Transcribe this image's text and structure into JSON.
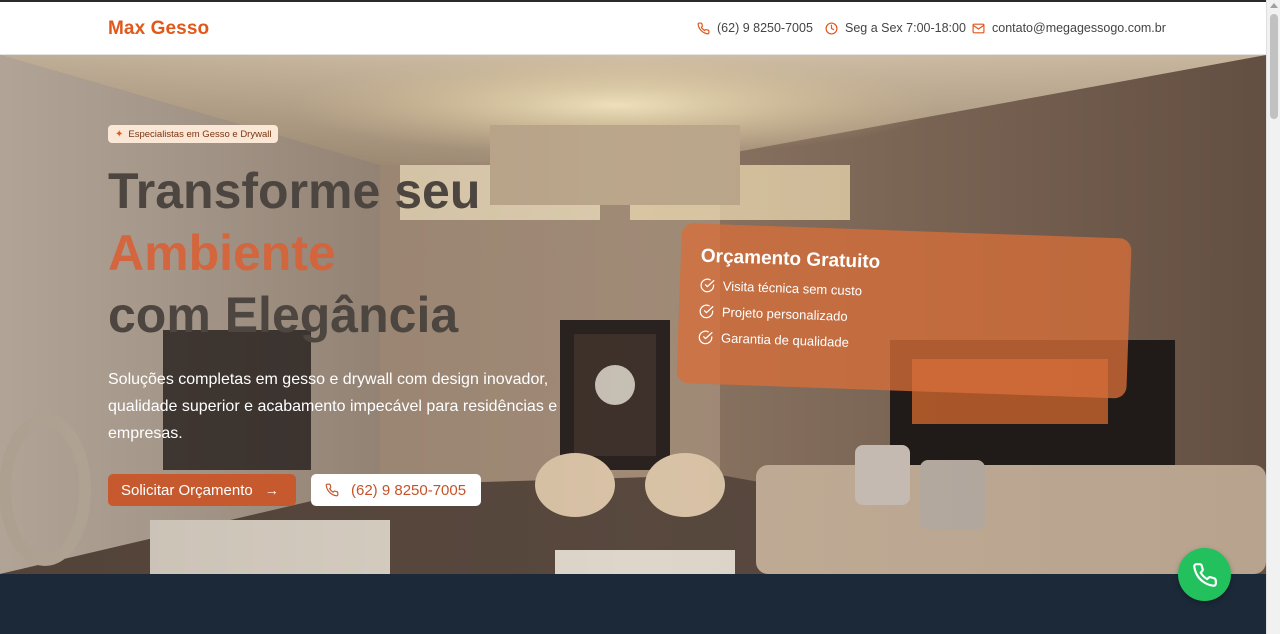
{
  "header": {
    "brand": "Max Gesso",
    "phone": "(62) 9 8250-7005",
    "hours": "Seg a Sex 7:00-18:00",
    "email": "contato@megagessogo.com.br"
  },
  "hero": {
    "badge": "Especialistas em Gesso e Drywall",
    "headline_line1": "Transforme seu",
    "headline_accent": "Ambiente",
    "headline_line3": "com Elegância",
    "subtext": "Soluções completas em gesso e drywall com design inovador, qualidade superior e acabamento impecável para residências e empresas.",
    "cta_primary": "Solicitar Orçamento",
    "cta_phone": "(62) 9 8250-7005"
  },
  "quote_card": {
    "title": "Orçamento Gratuito",
    "items": [
      "Visita técnica sem custo",
      "Projeto personalizado",
      "Garantia de qualidade"
    ]
  },
  "colors": {
    "brand": "#e2571a",
    "primary_button": "#c65a2e",
    "whatsapp": "#22c15e",
    "footer_band": "#1c2939"
  },
  "icons": {
    "phone": "phone-icon",
    "hours": "clock-icon",
    "email": "mail-icon",
    "badge": "sparkle-icon",
    "check": "check-circle-icon",
    "arrow": "arrow-right-icon",
    "whatsapp": "whatsapp-icon"
  }
}
